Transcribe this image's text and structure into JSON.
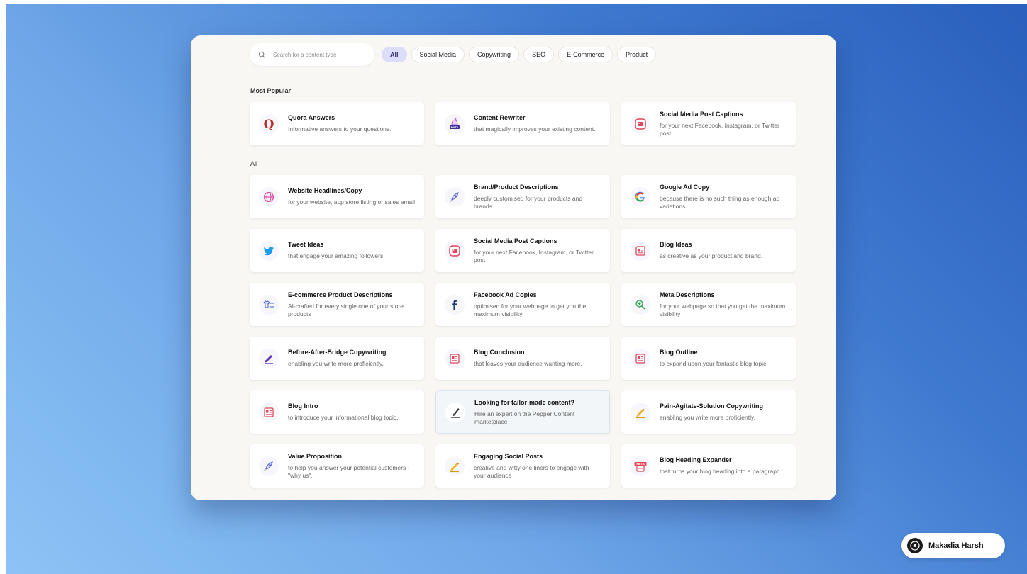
{
  "search": {
    "placeholder": "Search for a content type"
  },
  "filters": [
    {
      "label": "All",
      "active": true
    },
    {
      "label": "Social Media"
    },
    {
      "label": "Copywriting"
    },
    {
      "label": "SEO"
    },
    {
      "label": "E-Commerce"
    },
    {
      "label": "Product"
    }
  ],
  "sections": {
    "popular": "Most Popular",
    "all": "All"
  },
  "popular": [
    {
      "icon": "quora-icon",
      "title": "Quora Answers",
      "desc": "Informative answers to your questions."
    },
    {
      "icon": "unicorn-meta-icon",
      "title": "Content Rewriter",
      "desc": "that magically improves your existing content."
    },
    {
      "icon": "image-post-icon",
      "title": "Social Media Post Captions",
      "desc": "for your next Facebook, Instagram, or Twitter post"
    }
  ],
  "all_items": [
    {
      "icon": "globe-icon",
      "title": "Website Headlines/Copy",
      "desc": "for your website, app store listing or sales email"
    },
    {
      "icon": "rocket-icon",
      "title": "Brand/Product Descriptions",
      "desc": "deeply customised for your products and brands."
    },
    {
      "icon": "google-icon",
      "title": "Google Ad Copy",
      "desc": "because there is no such thing as enough ad variations."
    },
    {
      "icon": "twitter-icon",
      "title": "Tweet Ideas",
      "desc": "that engage your amazing followers"
    },
    {
      "icon": "image-post-icon",
      "title": "Social Media Post Captions",
      "desc": "for your next Facebook, Instagram, or Twitter post"
    },
    {
      "icon": "blog-icon",
      "title": "Blog Ideas",
      "desc": "as creative as your product and brand."
    },
    {
      "icon": "shirt-list-icon",
      "title": "E-commerce Product Descriptions",
      "desc": "AI-crafted for every single one of your store products"
    },
    {
      "icon": "facebook-icon",
      "title": "Facebook Ad Copies",
      "desc": "optimised for your webpage to get you the maximum visibility"
    },
    {
      "icon": "magnifier-icon",
      "title": "Meta Descriptions",
      "desc": "for your webpage so that you get the maximum visibility"
    },
    {
      "icon": "pen-icon",
      "title": "Before-After-Bridge Copywriting",
      "desc": "enabling you write more proficiently."
    },
    {
      "icon": "blog-icon",
      "title": "Blog Conclusion",
      "desc": "that leaves your audience wanting more."
    },
    {
      "icon": "blog-icon",
      "title": "Blog Outline",
      "desc": "to expand upon your fantastic blog topic."
    },
    {
      "icon": "blog-icon",
      "title": "Blog Intro",
      "desc": "to introduce your informational blog topic."
    },
    {
      "icon": "quill-icon",
      "title": "Looking for tailor-made content?",
      "desc": "Hire an expert on the Pepper Content marketplace",
      "special": true
    },
    {
      "icon": "pencil-icon",
      "title": "Pain-Agitate-Solution Copywriting",
      "desc": "enabling you write more proficiently."
    },
    {
      "icon": "rocket-icon",
      "title": "Value Proposition",
      "desc": "to help you answer your potential customers - \"why us\"."
    },
    {
      "icon": "pencil-icon",
      "title": "Engaging Social Posts",
      "desc": "creative and witty one liners to engage with your audience"
    },
    {
      "icon": "meta-blog-icon",
      "title": "Blog Heading Expander",
      "desc": "that turns your blog heading into a paragraph."
    }
  ],
  "badge": {
    "name": "Makadia Harsh"
  }
}
